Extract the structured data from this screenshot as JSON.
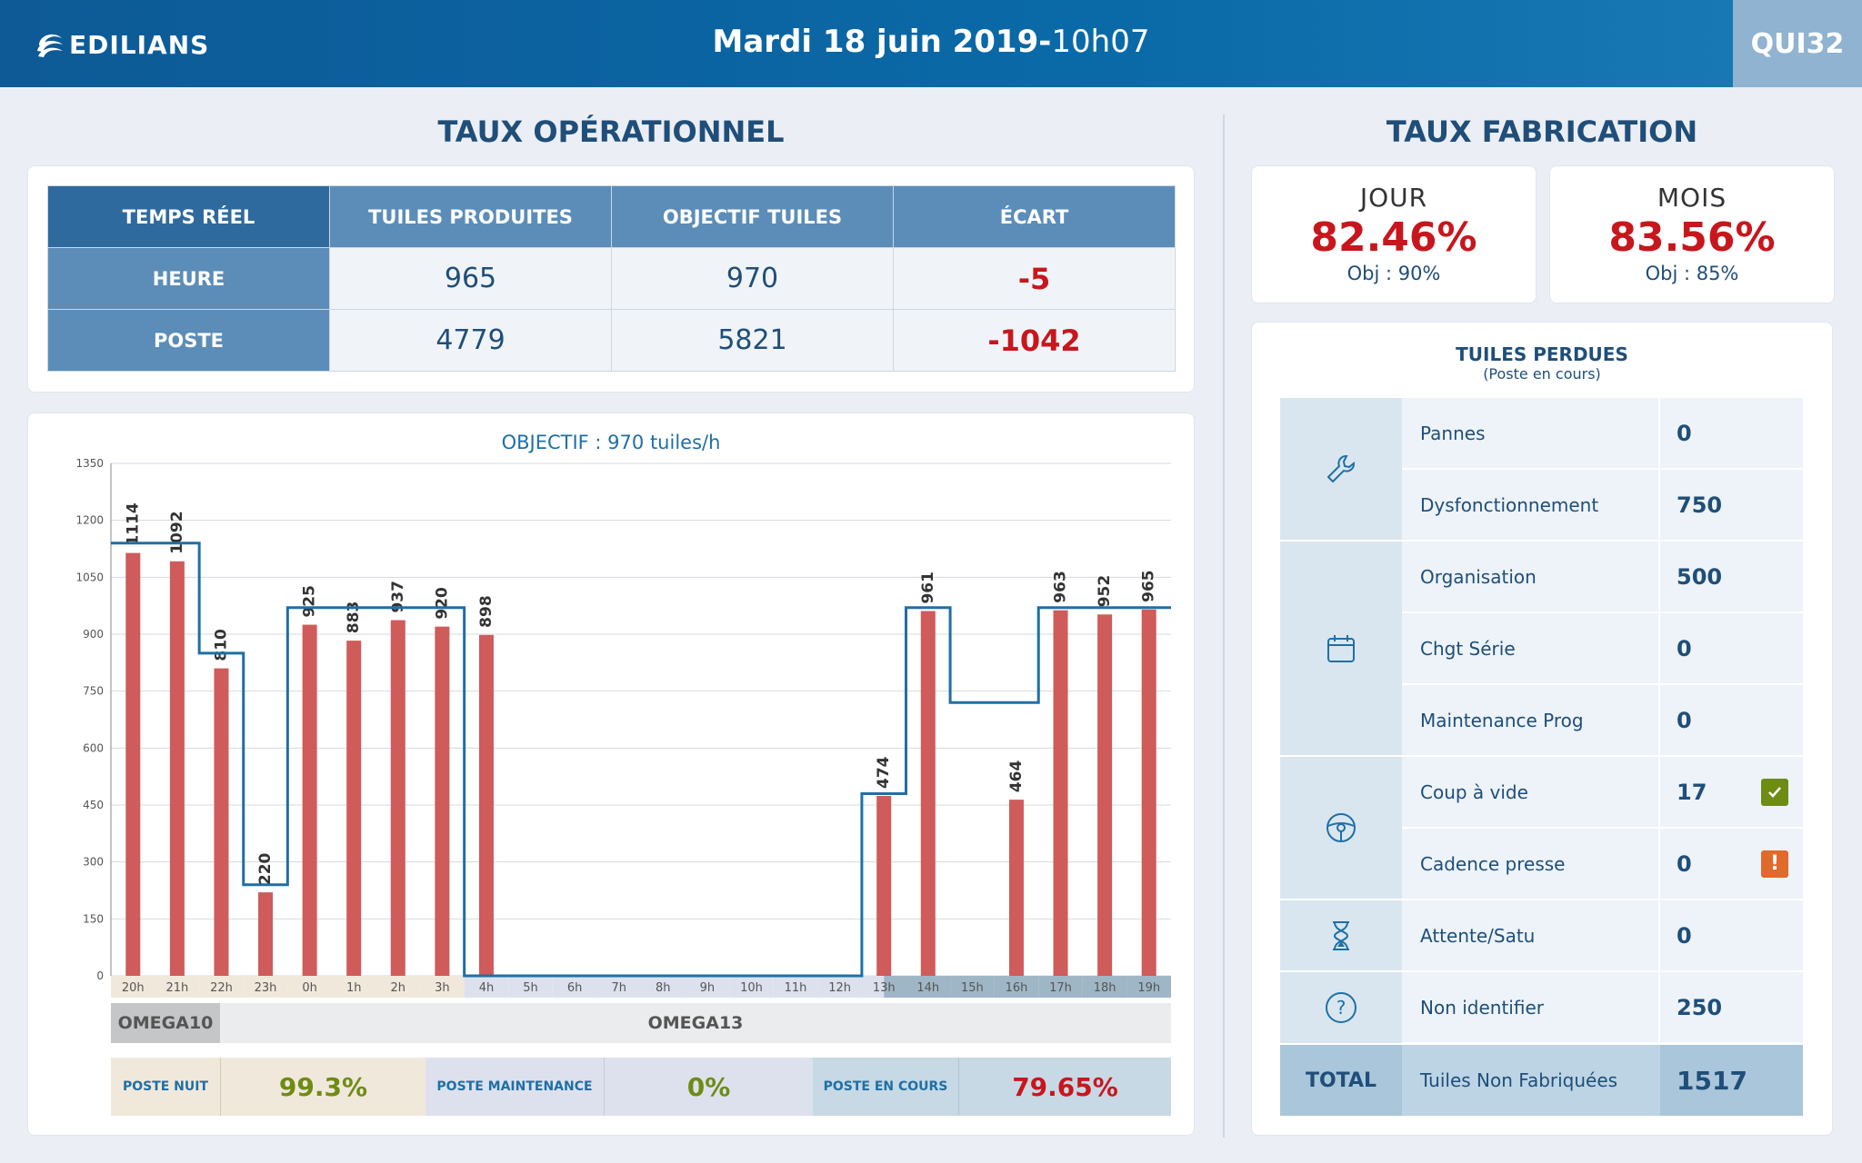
{
  "header": {
    "brand": "EDILIANS",
    "date": "Mardi 18 juin 2019",
    "separator": "-",
    "time": "10h07",
    "code": "QUI32"
  },
  "left": {
    "title": "TAUX OPÉRATIONNEL",
    "table": {
      "headers": [
        "TEMPS RÉEL",
        "TUILES PRODUITES",
        "OBJECTIF TUILES",
        "ÉCART"
      ],
      "rows": [
        {
          "label": "HEURE",
          "produced": "965",
          "target": "970",
          "gap": "-5"
        },
        {
          "label": "POSTE",
          "produced": "4779",
          "target": "5821",
          "gap": "-1042"
        }
      ]
    },
    "chart_title": "OBJECTIF : 970 tuiles/h",
    "omega": {
      "a": "OMEGA10",
      "b": "OMEGA13"
    },
    "postes": [
      {
        "label": "POSTE NUIT",
        "value": "99.3%"
      },
      {
        "label": "POSTE MAINTENANCE",
        "value": "0%"
      },
      {
        "label": "POSTE EN COURS",
        "value": "79.65%"
      }
    ]
  },
  "right": {
    "title": "TAUX FABRICATION",
    "kpis": [
      {
        "label": "JOUR",
        "value": "82.46%",
        "objective": "Obj : 90%"
      },
      {
        "label": "MOIS",
        "value": "83.56%",
        "objective": "Obj : 85%"
      }
    ],
    "lost": {
      "title": "TUILES PERDUES",
      "subtitle": "(Poste en cours)",
      "groups": [
        {
          "icon": "wrench-icon",
          "rows": [
            {
              "name": "Pannes",
              "value": "0"
            },
            {
              "name": "Dysfonctionnement",
              "value": "750"
            }
          ]
        },
        {
          "icon": "calendar-icon",
          "rows": [
            {
              "name": "Organisation",
              "value": "500"
            },
            {
              "name": "Chgt Série",
              "value": "0"
            },
            {
              "name": "Maintenance Prog",
              "value": "0"
            }
          ]
        },
        {
          "icon": "steering-wheel-icon",
          "rows": [
            {
              "name": "Coup à vide",
              "value": "17",
              "flag": "check"
            },
            {
              "name": "Cadence presse",
              "value": "0",
              "flag": "warning"
            }
          ]
        },
        {
          "icon": "hourglass-icon",
          "rows": [
            {
              "name": "Attente/Satu",
              "value": "0"
            }
          ]
        },
        {
          "icon": "question-icon",
          "rows": [
            {
              "name": "Non identifier",
              "value": "250"
            }
          ]
        }
      ],
      "total": {
        "label": "TOTAL",
        "name": "Tuiles Non Fabriquées",
        "value": "1517"
      }
    }
  },
  "colors": {
    "bar": "#cf5b5b",
    "target_line": "#1f6fa5",
    "negative": "#c8161d",
    "positive_green": "#6e8c14",
    "check": "#6e8c14",
    "warning": "#e06a2c",
    "shift_night": "#f1e8dc",
    "shift_maintenance": "#dde1ee",
    "shift_current": "#c7d9e5"
  },
  "chart_data": {
    "type": "bar",
    "title": "OBJECTIF : 970 tuiles/h",
    "categories": [
      "20h",
      "21h",
      "22h",
      "23h",
      "0h",
      "1h",
      "2h",
      "3h",
      "4h",
      "5h",
      "6h",
      "7h",
      "8h",
      "9h",
      "10h",
      "11h",
      "12h",
      "13h",
      "14h",
      "15h",
      "16h",
      "17h",
      "18h",
      "19h"
    ],
    "series": [
      {
        "values": [
          1114,
          1092,
          810,
          220,
          925,
          883,
          937,
          920,
          898,
          0,
          0,
          0,
          0,
          0,
          0,
          0,
          0,
          474,
          961,
          0,
          464,
          963,
          952,
          965
        ]
      }
    ],
    "target_step": [
      1140,
      1140,
      850,
      240,
      970,
      970,
      970,
      970,
      0,
      0,
      0,
      0,
      0,
      0,
      0,
      0,
      0,
      480,
      970,
      720,
      720,
      970,
      970,
      970
    ],
    "ylim": [
      0,
      1350
    ],
    "yticks": [
      0,
      150,
      300,
      450,
      600,
      750,
      900,
      1050,
      1200,
      1350
    ],
    "grid": true
  }
}
